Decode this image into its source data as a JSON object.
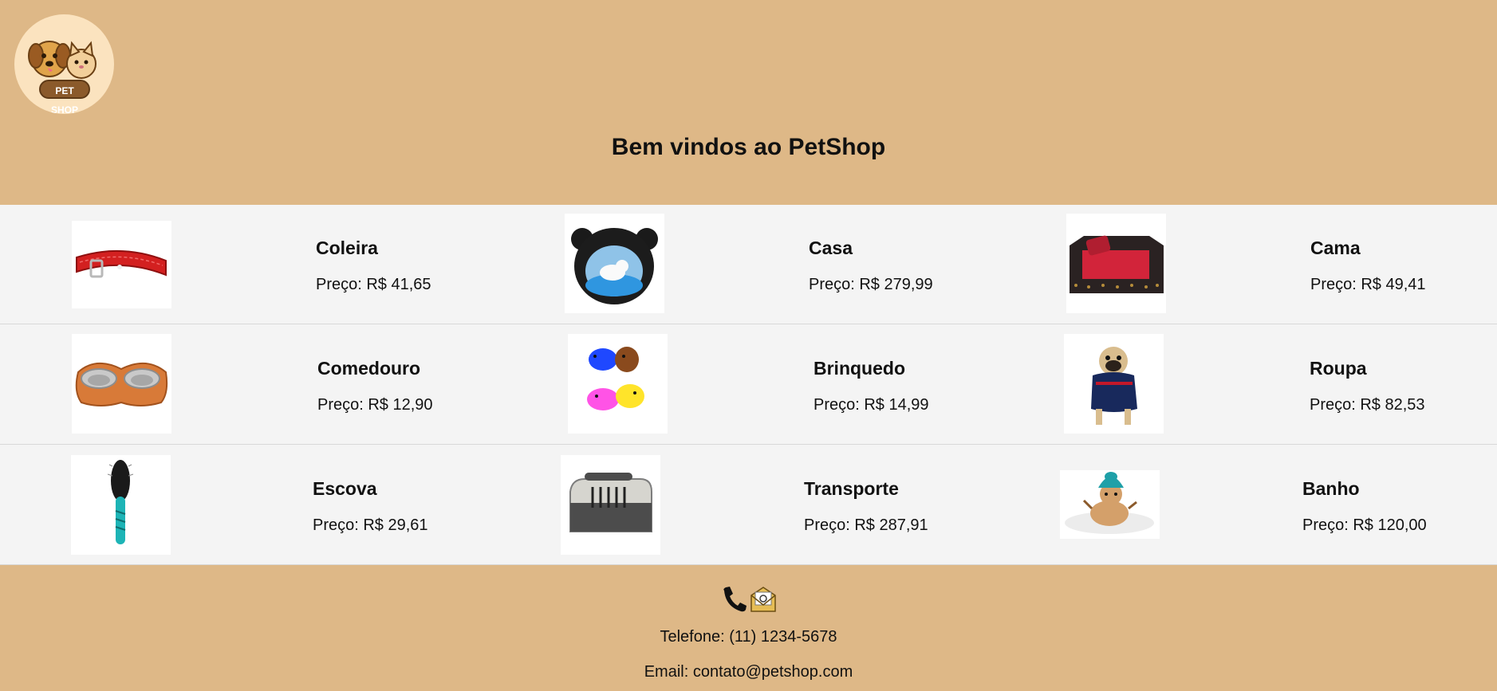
{
  "header": {
    "logo_text": "PET SHOP",
    "title": "Bem vindos ao PetShop"
  },
  "products": [
    {
      "name": "Coleira",
      "price": "Preço: R$ 41,65",
      "icon": "red-collar-icon"
    },
    {
      "name": "Casa",
      "price": "Preço: R$ 279,99",
      "icon": "pet-house-icon"
    },
    {
      "name": "Cama",
      "price": "Preço: R$ 49,41",
      "icon": "pet-bed-icon"
    },
    {
      "name": "Comedouro",
      "price": "Preço: R$ 12,90",
      "icon": "food-bowl-icon"
    },
    {
      "name": "Brinquedo",
      "price": "Preço: R$ 14,99",
      "icon": "toy-pigs-icon"
    },
    {
      "name": "Roupa",
      "price": "Preço: R$ 82,53",
      "icon": "dog-clothes-icon"
    },
    {
      "name": "Escova",
      "price": "Preço: R$ 29,61",
      "icon": "brush-icon"
    },
    {
      "name": "Transporte",
      "price": "Preço: R$ 287,91",
      "icon": "pet-carrier-icon"
    },
    {
      "name": "Banho",
      "price": "Preço: R$ 120,00",
      "icon": "dog-bath-icon"
    }
  ],
  "footer": {
    "phone": "Telefone: (11) 1234-5678",
    "email": "Email: contato@petshop.com"
  },
  "colors": {
    "header_bg": "#deb887",
    "content_bg": "#f4f4f4",
    "logo_bg": "#fbe3bf"
  }
}
